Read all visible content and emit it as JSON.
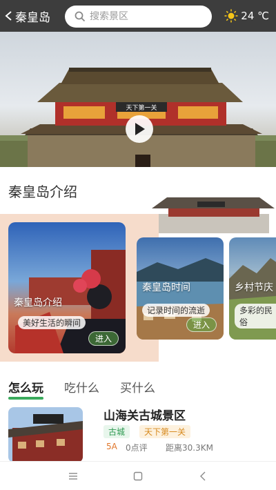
{
  "header": {
    "city": "秦皇岛",
    "search_placeholder": "搜索景区",
    "weather": "24 ℃",
    "weather_icon": "sun-icon"
  },
  "hero": {
    "play_icon": "play-icon",
    "gate_sign": "天下第一关"
  },
  "intro": {
    "title": "秦皇岛介绍",
    "cards": [
      {
        "title": "秦皇岛介绍",
        "subtitle": "美好生活的瞬间",
        "enter": "进入"
      },
      {
        "title": "秦皇岛时间",
        "subtitle": "记录时间的流逝",
        "enter": "进入"
      },
      {
        "title": "乡村节庆",
        "subtitle": "多彩的民俗"
      }
    ]
  },
  "tabs": [
    "怎么玩",
    "吃什么",
    "买什么"
  ],
  "listing": {
    "name": "山海关古城景区",
    "tags": [
      "古城",
      "天下第一关"
    ],
    "level": "5A",
    "reviews": "0点评",
    "distance": "距离30.3KM"
  },
  "colors": {
    "accent": "#3aaa5c",
    "header_bg": "#3d3d3d",
    "intro_band": "#f6dccb"
  }
}
